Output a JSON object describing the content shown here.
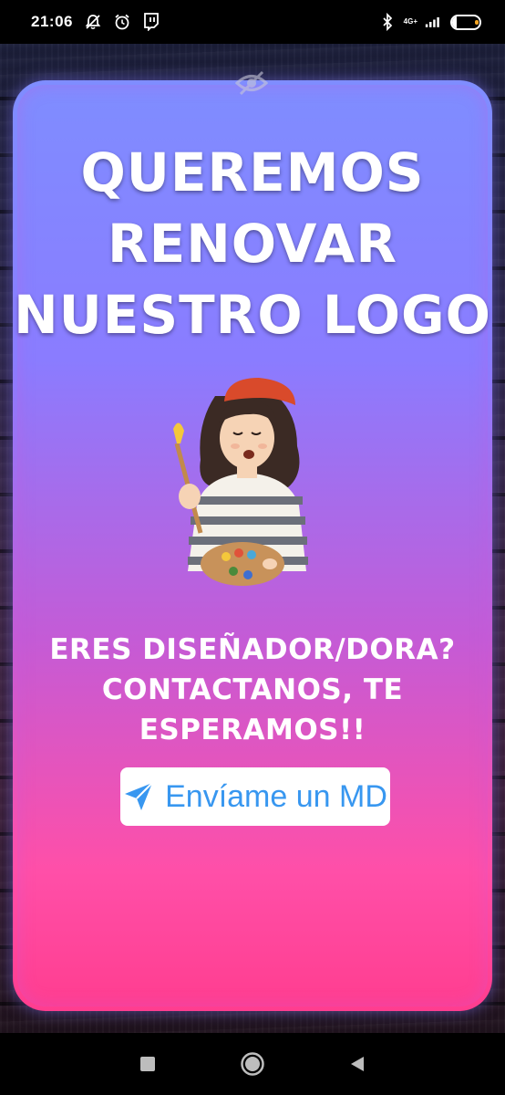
{
  "status_bar": {
    "time": "21:06",
    "network": "4G+",
    "battery": "18",
    "battery_level": 0.18,
    "icons": [
      "notifications-off-icon",
      "alarm-icon",
      "twitch-icon",
      "bluetooth-icon",
      "signal-icon",
      "battery-icon"
    ]
  },
  "story": {
    "headline": [
      "QUEREMOS",
      "RENOVAR",
      "NUESTRO LOGO"
    ],
    "subtext": [
      "ERES DISEÑADOR/DORA?",
      "CONTACTANOS, TE",
      "ESPERAMOS!!"
    ],
    "dm_button_label": "Envíame un MD",
    "colors": {
      "button_text": "#3897f0",
      "frame_top": "#7f8dff",
      "frame_bottom": "#ff3d8f"
    }
  },
  "nav_bar": {
    "icons": [
      "recents-square-icon",
      "home-circle-icon",
      "back-triangle-icon"
    ]
  }
}
